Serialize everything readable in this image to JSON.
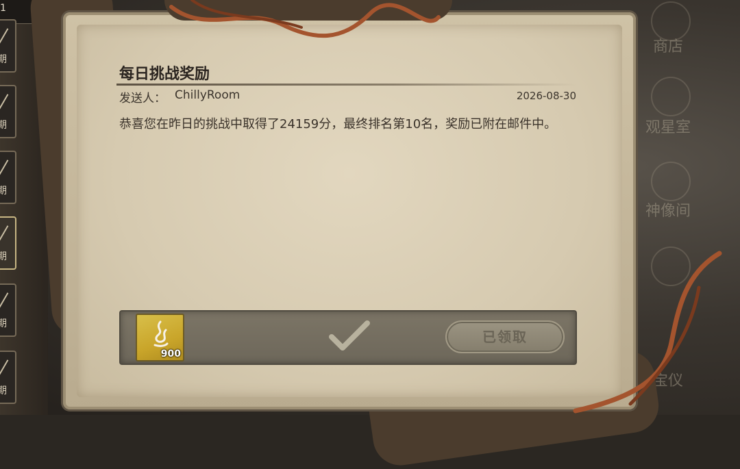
{
  "left_tabs": {
    "top_label": "1",
    "items": [
      {
        "char": "期"
      },
      {
        "char": "期"
      },
      {
        "char": "期"
      },
      {
        "char": "期"
      },
      {
        "char": "期"
      },
      {
        "char": "期"
      }
    ]
  },
  "right_menu": {
    "items": [
      {
        "label": "商店"
      },
      {
        "label": "观星室"
      },
      {
        "label": "神像间"
      },
      {
        "label": "宝仪"
      }
    ]
  },
  "mail": {
    "title": "每日挑战奖励",
    "sender_label": "发送人：",
    "sender_name": "ChillyRoom",
    "date": "2026-08-30",
    "body": "恭喜您在昨日的挑战中取得了24159分，最终排名第10名，奖励已附在邮件中。"
  },
  "reward": {
    "icon": "soul-flame-icon",
    "count": "900",
    "claimed_label": "已领取",
    "colors": {
      "slot": "#c9a52a",
      "bar": "#6d675a"
    }
  }
}
